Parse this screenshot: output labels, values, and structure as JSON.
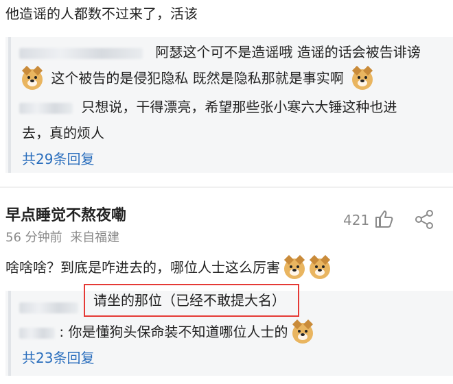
{
  "top_comment": {
    "text": "他造谣的人都数不过来了，活该",
    "replies": [
      {
        "text": "阿瑟这个可不是造谣哦 造谣的话会被告诽谤"
      },
      {
        "text": "这个被告的是侵犯隐私 既然是隐私那就是事实啊"
      },
      {
        "text_line1": "只想说，干得漂亮，希望那些张小寒六大锤这种也进",
        "text_line2": "去，真的烦人"
      }
    ],
    "reply_count": "共29条回复"
  },
  "comment": {
    "username": "早点睡觉不熬夜嘞",
    "meta": "56 分钟前  来自福建",
    "like_count": "421",
    "text": "啥啥啥？到底是咋进去的，哪位人士这么厉害",
    "replies": [
      {
        "text": "请坐的那位（已经不敢提大名）"
      },
      {
        "text": ": 你是懂狗头保命装不知道哪位人士的"
      }
    ],
    "reply_count": "共23条回复"
  },
  "colors": {
    "link": "#2a6ebd",
    "highlight": "#e53935",
    "meta": "#8a8a8a"
  }
}
